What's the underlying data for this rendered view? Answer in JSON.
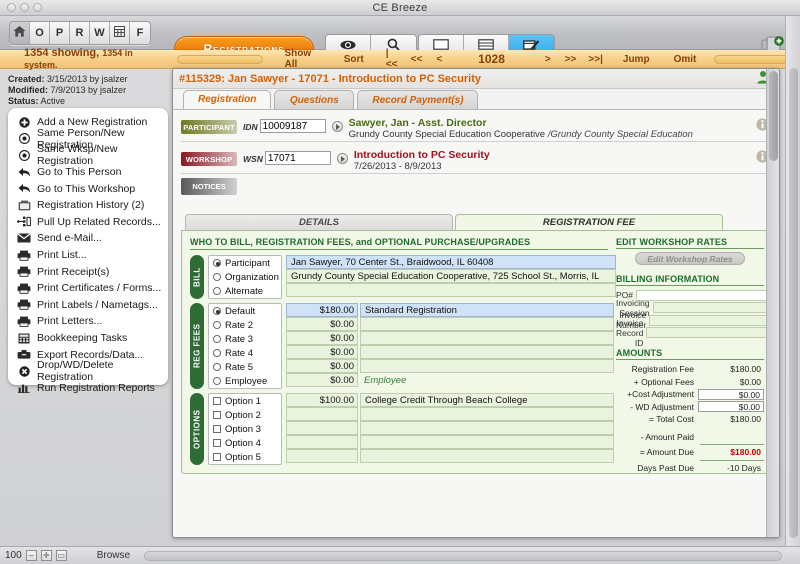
{
  "window": {
    "title": "CE Breeze"
  },
  "toolbar": {
    "nav_buttons": [
      {
        "icon": "home-icon",
        "label": ""
      },
      {
        "icon": "",
        "label": "O"
      },
      {
        "icon": "",
        "label": "P"
      },
      {
        "icon": "",
        "label": "R"
      },
      {
        "icon": "",
        "label": "W"
      },
      {
        "icon": "grid-icon",
        "label": ""
      },
      {
        "icon": "",
        "label": "F"
      }
    ],
    "module_tab": "Registrations",
    "view_buttons": [
      {
        "label": "Browse",
        "icon": "eye-icon",
        "active": false
      },
      {
        "label": "Search",
        "icon": "magnifier-icon",
        "active": false
      }
    ],
    "layout_buttons": [
      {
        "label": "Summary",
        "icon": "rectangle-icon",
        "active": false
      },
      {
        "label": "List",
        "icon": "lines-icon",
        "active": false
      },
      {
        "label": "Full/Edit",
        "icon": "pencil-icon",
        "active": true
      }
    ],
    "new_record_icon": "new-record-icon"
  },
  "statusbar": {
    "count_main": "1354 showing,",
    "count_sub": "1354 in system.",
    "show_all": "Show All",
    "sort": "Sort",
    "first": "|<<",
    "prev_page": "<<",
    "prev": "<",
    "record_number": "1028",
    "next": ">",
    "next_page": ">>",
    "last": ">>|",
    "jump": "Jump",
    "omit": "Omit"
  },
  "sidebar": {
    "meta": {
      "created_label": "Created:",
      "created_value": "3/15/2013 by jsalzer",
      "modified_label": "Modified:",
      "modified_value": "7/9/2013 by jsalzer",
      "status_label": "Status:",
      "status_value": "Active"
    },
    "items": [
      {
        "label": "Add a New Registration",
        "icon": "plus-circle-icon"
      },
      {
        "label": "Same Person/New Registration",
        "icon": "dot-circle-icon"
      },
      {
        "label": "Same Wksp/New Registration",
        "icon": "dot-circle-icon"
      },
      {
        "label": "Go to This Person",
        "icon": "back-arrow-icon"
      },
      {
        "label": "Go to This Workshop",
        "icon": "back-arrow-icon"
      },
      {
        "label": "Registration History (2)",
        "icon": "history-icon"
      },
      {
        "label": "Pull Up Related Records...",
        "icon": "related-records-icon"
      },
      {
        "label": "Send e-Mail...",
        "icon": "envelope-icon"
      },
      {
        "label": "Print List...",
        "icon": "printer-icon"
      },
      {
        "label": "Print Receipt(s)",
        "icon": "printer-icon"
      },
      {
        "label": "Print Certificates / Forms...",
        "icon": "printer-icon"
      },
      {
        "label": "Print Labels / Nametags...",
        "icon": "printer-icon"
      },
      {
        "label": "Print Letters...",
        "icon": "printer-icon"
      },
      {
        "label": "Bookkeeping Tasks",
        "icon": "calculator-icon"
      },
      {
        "label": "Export Records/Data...",
        "icon": "export-icon"
      },
      {
        "label": "Drop/WD/Delete Registration",
        "icon": "x-circle-icon"
      },
      {
        "label": "Run Registration Reports",
        "icon": "bar-chart-icon"
      }
    ]
  },
  "record": {
    "header": "#115329:  Jan Sawyer - 17071 - Introduction to PC Security",
    "header_icon": "person-icon",
    "tabs": [
      {
        "label": "Registration",
        "selected": true
      },
      {
        "label": "Questions",
        "selected": false
      },
      {
        "label": "Record Payment(s)",
        "selected": false
      }
    ],
    "collapse_icon": "collapse-icon"
  },
  "participant": {
    "chip": "PARTICIPANT",
    "id_label": "IDN",
    "id_value": "10009187",
    "go_icon": "play-icon",
    "name": "Sawyer, Jan - Asst. Director",
    "org": "Grundy County Special Education Cooperative ",
    "org_italic": "/Grundy County Special Education",
    "info_icon": "info-icon"
  },
  "workshop": {
    "chip": "WORKSHOP",
    "id_label": "WSN",
    "id_value": "17071",
    "go_icon": "play-icon",
    "title": "Introduction to PC Security",
    "dates": "7/26/2013 - 8/9/2013",
    "info_icon": "info-icon"
  },
  "notices": {
    "chip": "NOTICES"
  },
  "inner_tabs": [
    {
      "label": "DETAILS",
      "selected": false
    },
    {
      "label": "REGISTRATION FEE",
      "selected": true
    }
  ],
  "fee_panel": {
    "section_title": "WHO TO BILL, REGISTRATION FEES, and OPTIONAL PURCHASE/UPGRADES",
    "bill": {
      "vlabel": "BILL",
      "rows": [
        {
          "option": "Participant",
          "selected": true,
          "value": "Jan Sawyer, 70 Center St., Braidwood, IL  60408"
        },
        {
          "option": "Organization",
          "selected": false,
          "value": "Grundy County Special Education Cooperative, 725 School St., Morris, IL"
        },
        {
          "option": "Alternate",
          "selected": false,
          "value": ""
        }
      ]
    },
    "reg_fees": {
      "vlabel": "REG FEES",
      "rows": [
        {
          "option": "Default",
          "selected": true,
          "amount": "$180.00",
          "desc": "Standard Registration",
          "italic": false
        },
        {
          "option": "Rate 2",
          "selected": false,
          "amount": "$0.00",
          "desc": "",
          "italic": false
        },
        {
          "option": "Rate 3",
          "selected": false,
          "amount": "$0.00",
          "desc": "",
          "italic": false
        },
        {
          "option": "Rate 4",
          "selected": false,
          "amount": "$0.00",
          "desc": "",
          "italic": false
        },
        {
          "option": "Rate 5",
          "selected": false,
          "amount": "$0.00",
          "desc": "",
          "italic": false
        },
        {
          "option": "Employee",
          "selected": false,
          "amount": "$0.00",
          "desc": "Employee",
          "italic": true
        }
      ]
    },
    "options": {
      "vlabel": "OPTIONS",
      "rows": [
        {
          "option": "Option 1",
          "checked": false,
          "amount": "$100.00",
          "desc": "College Credit Through Beach College"
        },
        {
          "option": "Option 2",
          "checked": false,
          "amount": "",
          "desc": ""
        },
        {
          "option": "Option 3",
          "checked": false,
          "amount": "",
          "desc": ""
        },
        {
          "option": "Option 4",
          "checked": false,
          "amount": "",
          "desc": ""
        },
        {
          "option": "Option 5",
          "checked": false,
          "amount": "",
          "desc": ""
        }
      ]
    },
    "edit_rates": {
      "title": "EDIT WORKSHOP RATES",
      "button": "Edit Workshop Rates"
    },
    "billing_information": {
      "title": "BILLING INFORMATION",
      "fields": [
        {
          "label": "PO#",
          "value": ""
        },
        {
          "label": "Invoicing Session",
          "value": ""
        },
        {
          "label": "Invoice Number",
          "value": ""
        },
        {
          "label": "Invoice Record ID",
          "value": ""
        }
      ]
    },
    "amounts": {
      "title": "AMOUNTS",
      "rows": [
        {
          "label": "Registration Fee",
          "value": "$180.00",
          "boxed": false,
          "style": "normal"
        },
        {
          "label": "+ Optional Fees",
          "value": "$0.00",
          "boxed": false,
          "style": "normal"
        },
        {
          "label": "+Cost Adjustment",
          "value": "$0.00",
          "boxed": true,
          "style": "normal"
        },
        {
          "label": "- WD Adjustment",
          "value": "$0.00",
          "boxed": true,
          "style": "normal"
        },
        {
          "label": "= Total Cost",
          "value": "$180.00",
          "boxed": false,
          "style": "normal"
        },
        {
          "label": "- Amount Paid",
          "value": "",
          "boxed": false,
          "style": "normal"
        },
        {
          "label": "= Amount Due",
          "value": "$180.00",
          "boxed": false,
          "style": "due"
        },
        {
          "label": "Days Past Due",
          "value": "-10 Days",
          "boxed": false,
          "style": "normal"
        }
      ]
    }
  },
  "bottombar": {
    "zoom_level": "100",
    "mode": "Browse"
  },
  "colors": {
    "accent_orange": "#d26207",
    "status_strip": "#f7d089",
    "green_panel": "#f1f8e7",
    "green_label": "#2f6b34",
    "due_red": "#cc0000",
    "participant_green": "#6f7a1c",
    "workshop_red": "#8d1622",
    "active_blue": "#1d9fe8"
  }
}
